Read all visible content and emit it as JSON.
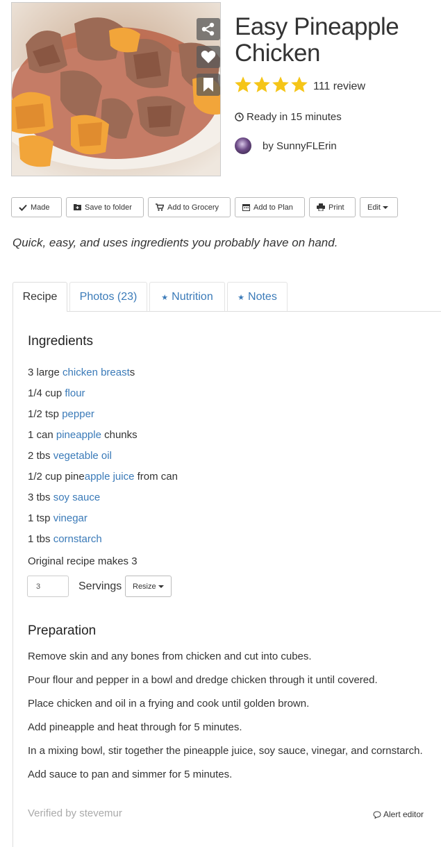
{
  "recipe": {
    "title": "Easy Pineapple Chicken",
    "rating_stars": 4,
    "rating_max": 5,
    "review_text": "111 review",
    "ready_text": "Ready in 15 minutes",
    "author_text": "by SunnyFLErin",
    "tagline": "Quick, easy, and uses ingredients you probably have on hand."
  },
  "hero_actions": [
    "share-icon",
    "heart-icon",
    "bookmark-icon"
  ],
  "actions": {
    "made": "Made",
    "save": "Save to folder",
    "grocery": "Add to Grocery",
    "plan": "Add to Plan",
    "print": "Print",
    "edit": "Edit"
  },
  "tabs": {
    "recipe": "Recipe",
    "photos": "Photos (23)",
    "nutrition": "Nutrition",
    "notes": "Notes"
  },
  "ingredients_heading": "Ingredients",
  "ingredients": [
    {
      "pre": "3 large ",
      "link": "chicken breast",
      "post": "s"
    },
    {
      "pre": "1/4 cup ",
      "link": "flour",
      "post": ""
    },
    {
      "pre": "1/2 tsp ",
      "link": "pepper",
      "post": ""
    },
    {
      "pre": "1 can ",
      "link": "pineapple",
      "post": " chunks"
    },
    {
      "pre": "2 tbs ",
      "link": "vegetable oil",
      "post": ""
    },
    {
      "pre": "1/2 cup pine",
      "link": "apple juice",
      "post": " from can"
    },
    {
      "pre": "3 tbs ",
      "link": "soy sauce",
      "post": ""
    },
    {
      "pre": "1 tsp ",
      "link": "vinegar",
      "post": ""
    },
    {
      "pre": "1 tbs ",
      "link": "cornstarch",
      "post": ""
    }
  ],
  "servings": {
    "makes_text": "Original recipe makes 3",
    "value": "3",
    "label": "Servings",
    "resize": "Resize"
  },
  "preparation_heading": "Preparation",
  "preparation": [
    "Remove skin and any bones from chicken and cut into cubes.",
    "Pour flour and pepper in a bowl and dredge chicken through it until covered.",
    "Place chicken and oil in a frying and cook until golden brown.",
    "Add pineapple and heat through for 5 minutes.",
    "In a mixing bowl, stir together the pineapple juice, soy sauce, vinegar, and cornstarch.",
    "Add sauce to pan and simmer for 5 minutes."
  ],
  "footer": {
    "verified": "Verified by stevemur",
    "alert": "Alert editor"
  },
  "colors": {
    "link": "#3a7ab8",
    "star": "#f5c518",
    "muted": "#aaaaaa"
  }
}
